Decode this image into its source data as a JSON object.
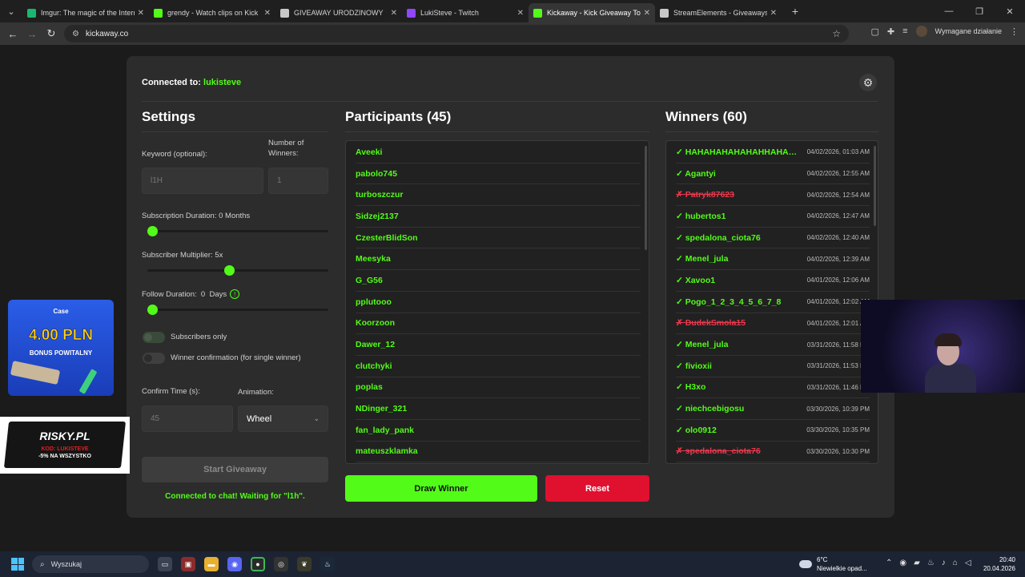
{
  "browser": {
    "tabs": [
      {
        "title": "Imgur: The magic of the Internet",
        "favicon_color": "#1bb76e",
        "active": false
      },
      {
        "title": "grendy - Watch clips on Kick",
        "favicon_color": "#53fc18",
        "active": false
      },
      {
        "title": "GIVEAWAY URODZINOWY",
        "favicon_color": "#c8c8c8",
        "active": false
      },
      {
        "title": "LukiSteve - Twitch",
        "favicon_color": "#9146ff",
        "active": false
      },
      {
        "title": "Kickaway - Kick Giveaway Tool",
        "favicon_color": "#53fc18",
        "active": true
      },
      {
        "title": "StreamElements - Giveaways",
        "favicon_color": "#c8c8c8",
        "active": false
      }
    ],
    "url": "kickaway.co",
    "profile_status": "Wymagane działanie"
  },
  "app": {
    "connected_label": "Connected to:",
    "channel": "lukisteve",
    "settings": {
      "title": "Settings",
      "keyword_label": "Keyword (optional):",
      "keyword_placeholder": "l1H",
      "winners_label_1": "Number of",
      "winners_label_2": "Winners:",
      "winners_placeholder": "1",
      "sub_duration_label": "Subscription Duration: 0 Months",
      "sub_duration_value": 0,
      "multiplier_label": "Subscriber Multiplier: 5x",
      "multiplier_value": 0.45,
      "follow_label": "Follow Duration:  0  Days",
      "follow_value": 0,
      "subscribers_only": "Subscribers only",
      "winner_confirmation": "Winner confirmation (for single winner)",
      "confirm_time_label": "Confirm Time (s):",
      "confirm_time_placeholder": "45",
      "animation_label": "Animation:",
      "animation_value": "Wheel",
      "start_button": "Start Giveaway",
      "status": "Connected to chat! Waiting for \"l1h\"."
    },
    "participants": {
      "title": "Participants (45)",
      "items": [
        "Aveeki",
        "pabolo745",
        "turboszczur",
        "Sidzej2137",
        "CzesterBlidSon",
        "Meesyka",
        "G_G56",
        "pplutooo",
        "Koorzoon",
        "Dawer_12",
        "clutchyki",
        "poplas",
        "NDinger_321",
        "fan_lady_pank",
        "mateuszklamka"
      ]
    },
    "winners": {
      "title": "Winners (60)",
      "items": [
        {
          "name": "HAHAHAHAHAHAHHAHAHAHA",
          "time": "04/02/2026, 01:03 AM",
          "ok": true
        },
        {
          "name": "Agantyi",
          "time": "04/02/2026, 12:55 AM",
          "ok": true
        },
        {
          "name": "Patryk87623",
          "time": "04/02/2026, 12:54 AM",
          "ok": false
        },
        {
          "name": "hubertos1",
          "time": "04/02/2026, 12:47 AM",
          "ok": true
        },
        {
          "name": "spedalona_ciota76",
          "time": "04/02/2026, 12:40 AM",
          "ok": true
        },
        {
          "name": "Menel_jula",
          "time": "04/02/2026, 12:39 AM",
          "ok": true
        },
        {
          "name": "Xavoo1",
          "time": "04/01/2026, 12:06 AM",
          "ok": true
        },
        {
          "name": "Pogo_1_2_3_4_5_6_7_8",
          "time": "04/01/2026, 12:02 AM",
          "ok": true
        },
        {
          "name": "DudekSmola15",
          "time": "04/01/2026, 12:01 AM",
          "ok": false
        },
        {
          "name": "Menel_jula",
          "time": "03/31/2026, 11:58 PM",
          "ok": true
        },
        {
          "name": "fivioxii",
          "time": "03/31/2026, 11:53 PM",
          "ok": true
        },
        {
          "name": "H3xo",
          "time": "03/31/2026, 11:46 PM",
          "ok": true
        },
        {
          "name": "niechcebigosu",
          "time": "03/30/2026, 10:39 PM",
          "ok": true
        },
        {
          "name": "olo0912",
          "time": "03/30/2026, 10:35 PM",
          "ok": true
        },
        {
          "name": "spedalona_ciota76",
          "time": "03/30/2026, 10:30 PM",
          "ok": false
        }
      ]
    },
    "draw_button": "Draw Winner",
    "reset_button": "Reset"
  },
  "overlays": {
    "promo_brand": "Case",
    "promo_amount": "4.00 PLN",
    "promo_sub": "BONUS POWITALNY",
    "risky_logo": "RISKY.PL",
    "risky_code": "KOD: LUKISTEVE",
    "risky_discount": "-5% NA WSZYSTKO"
  },
  "taskbar": {
    "search_placeholder": "Wyszukaj",
    "temp": "6°C",
    "weather": "Niewielkie opad...",
    "time": "20:40",
    "date": "20.04.2026"
  },
  "colors": {
    "kick_green": "#53fc18",
    "reset_red": "#e0102f",
    "error_red": "#e8394e"
  }
}
